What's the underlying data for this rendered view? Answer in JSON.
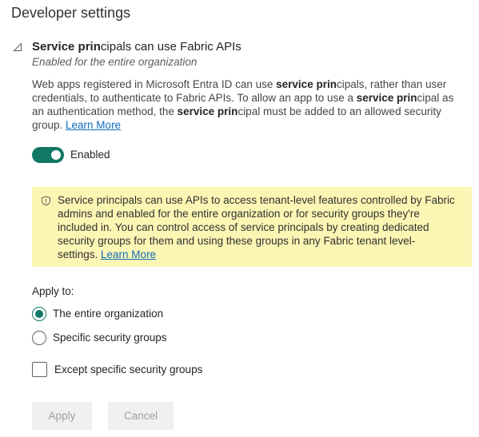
{
  "section": {
    "title": "Developer settings"
  },
  "setting": {
    "title_parts": {
      "a": "Service prin",
      "b": "cipals can use Fabric APIs"
    },
    "subtitle": "Enabled for the entire organization",
    "description": {
      "l1_a": "Web apps registered in Microsoft Entra ID can use ",
      "l1_b": "service prin",
      "l1_c": "cipals, rather than user",
      "l2": "credentials, to authenticate to Fabric APIs. To allow an app to use a ",
      "l2_b": "service prin",
      "l2_c": "cipal as",
      "l3_a": "an authentication method, the ",
      "l3_b": "service prin",
      "l3_c": "cipal must be added to an allowed security",
      "l4": "group. ",
      "learn_more": "Learn More"
    },
    "toggle": {
      "state": "on",
      "label": "Enabled",
      "color": "#117865"
    }
  },
  "warning": {
    "icon": "shield-icon",
    "background": "#fbf6b4",
    "lines": [
      "Service principals can use APIs to access tenant-level features controlled by Fabric",
      "admins and enabled for the entire organization or for security groups they're",
      "included in. You can control access of service principals by creating dedicated",
      "security groups for them and using these groups in any Fabric tenant level-",
      "settings. "
    ],
    "learn_more": "Learn More"
  },
  "apply_to": {
    "label": "Apply to:",
    "options": [
      {
        "label": "The entire organization",
        "selected": true
      },
      {
        "label": "Specific security groups",
        "selected": false
      }
    ],
    "except": {
      "label": "Except specific security groups",
      "checked": false
    }
  },
  "buttons": {
    "apply": "Apply",
    "cancel": "Cancel"
  }
}
